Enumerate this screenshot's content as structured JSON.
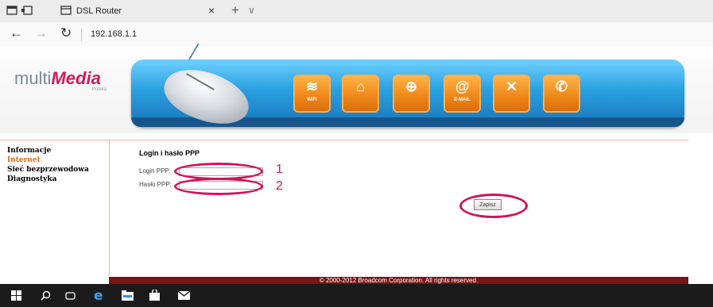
{
  "browser": {
    "tab_title": "DSL Router",
    "tab_close": "×",
    "new_tab": "+",
    "tab_more": "∨",
    "back": "←",
    "forward": "→",
    "refresh": "↻",
    "url": "192.168.1.1"
  },
  "logo": {
    "prefix": "multi",
    "brand": "Media",
    "sub": "Polska"
  },
  "banner_buttons": [
    {
      "icon": "wifi-icon",
      "glyph": "≋",
      "label": "WiFi"
    },
    {
      "icon": "home-icon",
      "glyph": "⌂",
      "label": ""
    },
    {
      "icon": "lock-icon",
      "glyph": "⊕",
      "label": ""
    },
    {
      "icon": "email-icon",
      "glyph": "@",
      "label": "E-MAIL"
    },
    {
      "icon": "tools-icon",
      "glyph": "✕",
      "label": ""
    },
    {
      "icon": "phone-icon",
      "glyph": "✆",
      "label": ""
    }
  ],
  "sidebar": {
    "items": [
      {
        "label": "Informacje",
        "active": false
      },
      {
        "label": "Internet",
        "active": true
      },
      {
        "label": "Sieć bezprzewodowa",
        "active": false
      },
      {
        "label": "Diagnostyka",
        "active": false
      }
    ]
  },
  "content": {
    "title": "Login i hasło PPP",
    "login_label": "Login PPP:",
    "login_value": "",
    "password_label": "Hasło PPP:",
    "password_value": "",
    "save_label": "Zapisz"
  },
  "annotations": {
    "login": "1",
    "password": "2"
  },
  "footer": "© 2000-2012 Broadcom Corporation. All rights reserved.",
  "colors": {
    "accent": "#d0145a",
    "active_nav": "#e66a0f",
    "banner": "#2aa0e0",
    "footer": "#7a1414"
  }
}
